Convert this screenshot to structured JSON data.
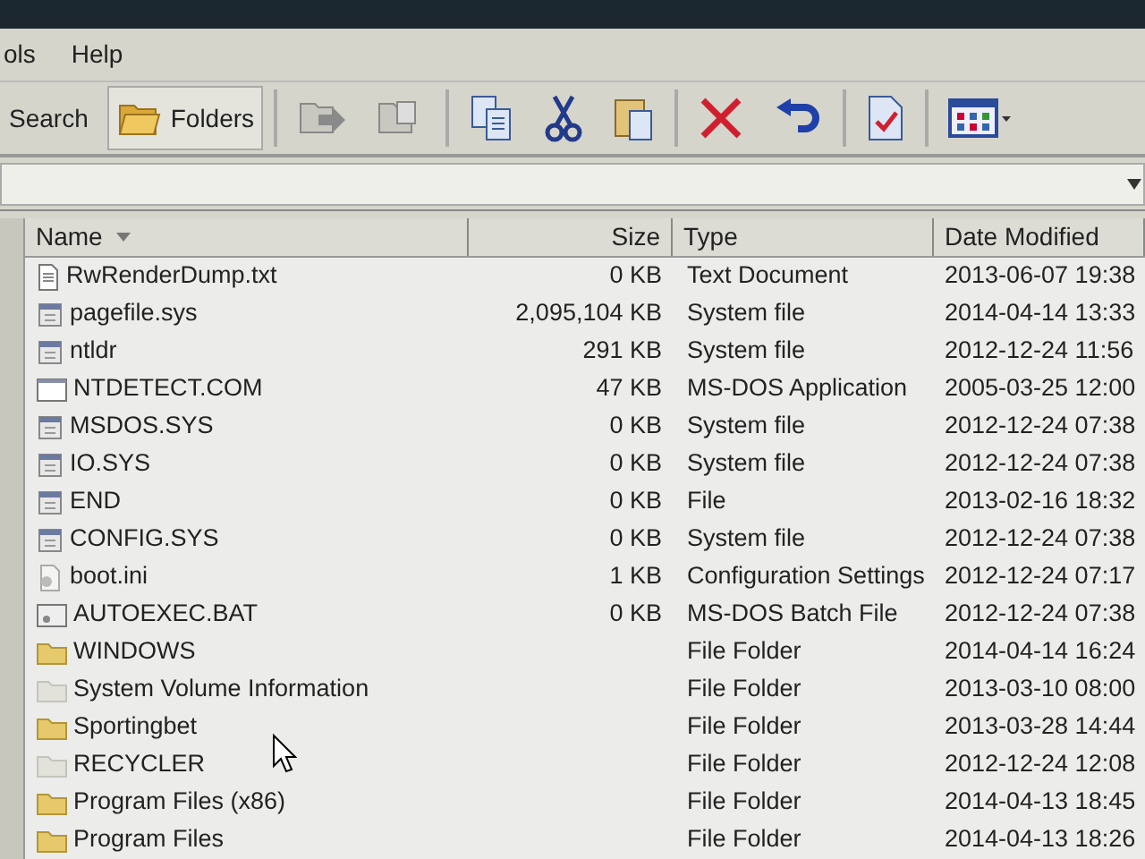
{
  "menu": [
    {
      "label": "ols"
    },
    {
      "label": "Help"
    }
  ],
  "toolbar": {
    "buttons": [
      {
        "kind": "text",
        "label": "Search",
        "selected": false
      },
      {
        "kind": "folders",
        "label": "Folders",
        "selected": true
      },
      {
        "kind": "move"
      },
      {
        "kind": "copyto"
      },
      {
        "kind": "copy"
      },
      {
        "kind": "cut"
      },
      {
        "kind": "paste"
      },
      {
        "kind": "delete"
      },
      {
        "kind": "undo"
      },
      {
        "kind": "properties"
      },
      {
        "kind": "views"
      }
    ]
  },
  "table": {
    "columns": [
      {
        "label": "Name",
        "sorted": true
      },
      {
        "label": "Size",
        "sorted": false
      },
      {
        "label": "Type",
        "sorted": false
      },
      {
        "label": "Date Modified",
        "sorted": false
      }
    ],
    "rows": [
      {
        "kind": "text",
        "name": "RwRenderDump.txt",
        "size": "0 KB",
        "type": "Text Document",
        "modified": "2013-06-07 19:38"
      },
      {
        "kind": "system",
        "name": "pagefile.sys",
        "size": "2,095,104 KB",
        "type": "System file",
        "modified": "2014-04-14 13:33"
      },
      {
        "kind": "system",
        "name": "ntldr",
        "size": "291 KB",
        "type": "System file",
        "modified": "2012-12-24 11:56"
      },
      {
        "kind": "app",
        "name": "NTDETECT.COM",
        "size": "47 KB",
        "type": "MS-DOS Application",
        "modified": "2005-03-25 12:00"
      },
      {
        "kind": "system",
        "name": "MSDOS.SYS",
        "size": "0 KB",
        "type": "System file",
        "modified": "2012-12-24 07:38"
      },
      {
        "kind": "system",
        "name": "IO.SYS",
        "size": "0 KB",
        "type": "System file",
        "modified": "2012-12-24 07:38"
      },
      {
        "kind": "system",
        "name": "END",
        "size": "0 KB",
        "type": "File",
        "modified": "2013-02-16 18:32"
      },
      {
        "kind": "system",
        "name": "CONFIG.SYS",
        "size": "0 KB",
        "type": "System file",
        "modified": "2012-12-24 07:38"
      },
      {
        "kind": "settings",
        "name": "boot.ini",
        "size": "1 KB",
        "type": "Configuration Settings",
        "modified": "2012-12-24 07:17"
      },
      {
        "kind": "batch",
        "name": "AUTOEXEC.BAT",
        "size": "0 KB",
        "type": "MS-DOS Batch File",
        "modified": "2012-12-24 07:38"
      },
      {
        "kind": "folder",
        "name": "WINDOWS",
        "type": "File Folder",
        "modified": "2014-04-14 16:24"
      },
      {
        "kind": "hidden_folder",
        "name": "System Volume Information",
        "type": "File Folder",
        "modified": "2013-03-10 08:00"
      },
      {
        "kind": "folder",
        "name": "Sportingbet",
        "type": "File Folder",
        "modified": "2013-03-28 14:44"
      },
      {
        "kind": "hidden_folder",
        "name": "RECYCLER",
        "type": "File Folder",
        "modified": "2012-12-24 12:08"
      },
      {
        "kind": "folder",
        "name": "Program Files (x86)",
        "type": "File Folder",
        "modified": "2014-04-13 18:45"
      },
      {
        "kind": "folder",
        "name": "Program Files",
        "type": "File Folder",
        "modified": "2014-04-13 18:26"
      }
    ]
  }
}
